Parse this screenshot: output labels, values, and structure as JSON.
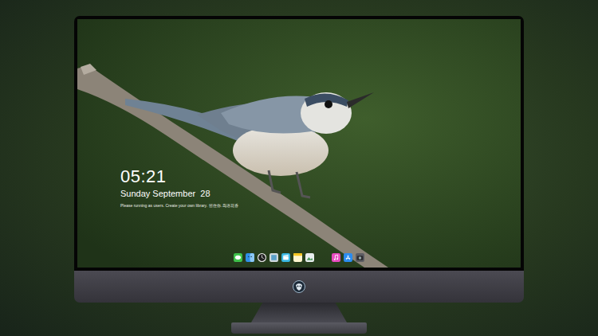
{
  "lock_screen": {
    "time": "05:21",
    "date": "Sunday September  28",
    "note": "Please running as users. Create your own library. 留住你. 鸟语花香"
  }
}
